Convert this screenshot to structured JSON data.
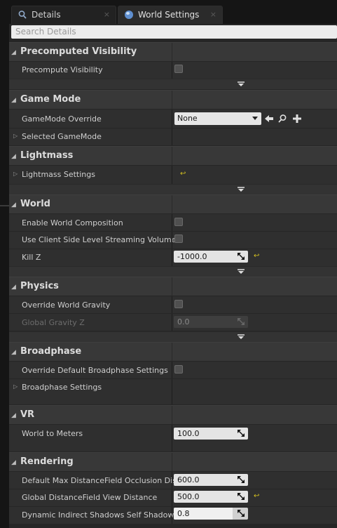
{
  "tabs": [
    {
      "label": "Details",
      "icon": "search-icon",
      "close": "×"
    },
    {
      "label": "World Settings",
      "icon": "globe-icon",
      "close": "×"
    }
  ],
  "search": {
    "placeholder": "Search Details"
  },
  "sections": {
    "precomputed_visibility": {
      "title": "Precomputed Visibility",
      "rows": {
        "precompute": "Precompute Visibility"
      }
    },
    "game_mode": {
      "title": "Game Mode",
      "rows": {
        "override": "GameMode Override",
        "selected": "Selected GameMode"
      },
      "override_value": "None"
    },
    "lightmass": {
      "title": "Lightmass",
      "rows": {
        "settings": "Lightmass Settings"
      }
    },
    "world": {
      "title": "World",
      "rows": {
        "composition": "Enable World Composition",
        "client_side": "Use Client Side Level Streaming Volumes",
        "kill_z": "Kill Z"
      },
      "kill_z_value": "-1000.0"
    },
    "physics": {
      "title": "Physics",
      "rows": {
        "override_gravity": "Override World Gravity",
        "global_gravity": "Global Gravity Z"
      },
      "global_gravity_value": "0.0"
    },
    "broadphase": {
      "title": "Broadphase",
      "rows": {
        "override": "Override Default Broadphase Settings",
        "settings": "Broadphase Settings"
      }
    },
    "vr": {
      "title": "VR",
      "rows": {
        "world_to_meters": "World to Meters"
      },
      "world_to_meters_value": "100.0"
    },
    "rendering": {
      "title": "Rendering",
      "rows": {
        "max_df": "Default Max DistanceField Occlusion Dista",
        "global_df": "Global DistanceField View Distance",
        "dyn_shadows": "Dynamic Indirect Shadows Self Shadowing"
      },
      "max_df_value": "600.0",
      "global_df_value": "500.0",
      "dyn_shadows_value": "0.8"
    }
  },
  "symbols": {
    "reset": "↩",
    "expand": "▷",
    "collapse": "◢"
  },
  "colors": {
    "reset_arrow": "#d4c020",
    "panel": "#262626",
    "header": "#383838",
    "row": "#2f2f2f"
  }
}
